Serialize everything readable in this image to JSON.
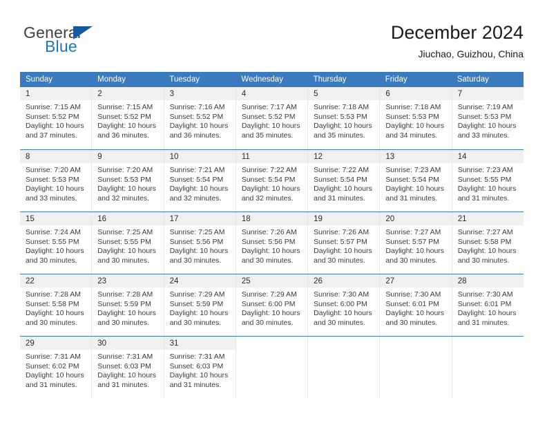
{
  "brand": {
    "name_part1": "General",
    "name_part2": "Blue",
    "accent_color": "#1b76c4",
    "triangle_color": "#17599c"
  },
  "header": {
    "title": "December 2024",
    "subtitle": "Jiuchao, Guizhou, China"
  },
  "theme": {
    "header_blue": "#3a7bbf",
    "daynum_band": "#f0f0f0",
    "cell_separator": "#e6e6e6"
  },
  "weekdays": [
    "Sunday",
    "Monday",
    "Tuesday",
    "Wednesday",
    "Thursday",
    "Friday",
    "Saturday"
  ],
  "weeks": [
    [
      {
        "day": "1",
        "sunrise": "Sunrise: 7:15 AM",
        "sunset": "Sunset: 5:52 PM",
        "daylight1": "Daylight: 10 hours",
        "daylight2": "and 37 minutes."
      },
      {
        "day": "2",
        "sunrise": "Sunrise: 7:15 AM",
        "sunset": "Sunset: 5:52 PM",
        "daylight1": "Daylight: 10 hours",
        "daylight2": "and 36 minutes."
      },
      {
        "day": "3",
        "sunrise": "Sunrise: 7:16 AM",
        "sunset": "Sunset: 5:52 PM",
        "daylight1": "Daylight: 10 hours",
        "daylight2": "and 36 minutes."
      },
      {
        "day": "4",
        "sunrise": "Sunrise: 7:17 AM",
        "sunset": "Sunset: 5:52 PM",
        "daylight1": "Daylight: 10 hours",
        "daylight2": "and 35 minutes."
      },
      {
        "day": "5",
        "sunrise": "Sunrise: 7:18 AM",
        "sunset": "Sunset: 5:53 PM",
        "daylight1": "Daylight: 10 hours",
        "daylight2": "and 35 minutes."
      },
      {
        "day": "6",
        "sunrise": "Sunrise: 7:18 AM",
        "sunset": "Sunset: 5:53 PM",
        "daylight1": "Daylight: 10 hours",
        "daylight2": "and 34 minutes."
      },
      {
        "day": "7",
        "sunrise": "Sunrise: 7:19 AM",
        "sunset": "Sunset: 5:53 PM",
        "daylight1": "Daylight: 10 hours",
        "daylight2": "and 33 minutes."
      }
    ],
    [
      {
        "day": "8",
        "sunrise": "Sunrise: 7:20 AM",
        "sunset": "Sunset: 5:53 PM",
        "daylight1": "Daylight: 10 hours",
        "daylight2": "and 33 minutes."
      },
      {
        "day": "9",
        "sunrise": "Sunrise: 7:20 AM",
        "sunset": "Sunset: 5:53 PM",
        "daylight1": "Daylight: 10 hours",
        "daylight2": "and 32 minutes."
      },
      {
        "day": "10",
        "sunrise": "Sunrise: 7:21 AM",
        "sunset": "Sunset: 5:54 PM",
        "daylight1": "Daylight: 10 hours",
        "daylight2": "and 32 minutes."
      },
      {
        "day": "11",
        "sunrise": "Sunrise: 7:22 AM",
        "sunset": "Sunset: 5:54 PM",
        "daylight1": "Daylight: 10 hours",
        "daylight2": "and 32 minutes."
      },
      {
        "day": "12",
        "sunrise": "Sunrise: 7:22 AM",
        "sunset": "Sunset: 5:54 PM",
        "daylight1": "Daylight: 10 hours",
        "daylight2": "and 31 minutes."
      },
      {
        "day": "13",
        "sunrise": "Sunrise: 7:23 AM",
        "sunset": "Sunset: 5:54 PM",
        "daylight1": "Daylight: 10 hours",
        "daylight2": "and 31 minutes."
      },
      {
        "day": "14",
        "sunrise": "Sunrise: 7:23 AM",
        "sunset": "Sunset: 5:55 PM",
        "daylight1": "Daylight: 10 hours",
        "daylight2": "and 31 minutes."
      }
    ],
    [
      {
        "day": "15",
        "sunrise": "Sunrise: 7:24 AM",
        "sunset": "Sunset: 5:55 PM",
        "daylight1": "Daylight: 10 hours",
        "daylight2": "and 30 minutes."
      },
      {
        "day": "16",
        "sunrise": "Sunrise: 7:25 AM",
        "sunset": "Sunset: 5:55 PM",
        "daylight1": "Daylight: 10 hours",
        "daylight2": "and 30 minutes."
      },
      {
        "day": "17",
        "sunrise": "Sunrise: 7:25 AM",
        "sunset": "Sunset: 5:56 PM",
        "daylight1": "Daylight: 10 hours",
        "daylight2": "and 30 minutes."
      },
      {
        "day": "18",
        "sunrise": "Sunrise: 7:26 AM",
        "sunset": "Sunset: 5:56 PM",
        "daylight1": "Daylight: 10 hours",
        "daylight2": "and 30 minutes."
      },
      {
        "day": "19",
        "sunrise": "Sunrise: 7:26 AM",
        "sunset": "Sunset: 5:57 PM",
        "daylight1": "Daylight: 10 hours",
        "daylight2": "and 30 minutes."
      },
      {
        "day": "20",
        "sunrise": "Sunrise: 7:27 AM",
        "sunset": "Sunset: 5:57 PM",
        "daylight1": "Daylight: 10 hours",
        "daylight2": "and 30 minutes."
      },
      {
        "day": "21",
        "sunrise": "Sunrise: 7:27 AM",
        "sunset": "Sunset: 5:58 PM",
        "daylight1": "Daylight: 10 hours",
        "daylight2": "and 30 minutes."
      }
    ],
    [
      {
        "day": "22",
        "sunrise": "Sunrise: 7:28 AM",
        "sunset": "Sunset: 5:58 PM",
        "daylight1": "Daylight: 10 hours",
        "daylight2": "and 30 minutes."
      },
      {
        "day": "23",
        "sunrise": "Sunrise: 7:28 AM",
        "sunset": "Sunset: 5:59 PM",
        "daylight1": "Daylight: 10 hours",
        "daylight2": "and 30 minutes."
      },
      {
        "day": "24",
        "sunrise": "Sunrise: 7:29 AM",
        "sunset": "Sunset: 5:59 PM",
        "daylight1": "Daylight: 10 hours",
        "daylight2": "and 30 minutes."
      },
      {
        "day": "25",
        "sunrise": "Sunrise: 7:29 AM",
        "sunset": "Sunset: 6:00 PM",
        "daylight1": "Daylight: 10 hours",
        "daylight2": "and 30 minutes."
      },
      {
        "day": "26",
        "sunrise": "Sunrise: 7:30 AM",
        "sunset": "Sunset: 6:00 PM",
        "daylight1": "Daylight: 10 hours",
        "daylight2": "and 30 minutes."
      },
      {
        "day": "27",
        "sunrise": "Sunrise: 7:30 AM",
        "sunset": "Sunset: 6:01 PM",
        "daylight1": "Daylight: 10 hours",
        "daylight2": "and 30 minutes."
      },
      {
        "day": "28",
        "sunrise": "Sunrise: 7:30 AM",
        "sunset": "Sunset: 6:01 PM",
        "daylight1": "Daylight: 10 hours",
        "daylight2": "and 31 minutes."
      }
    ],
    [
      {
        "day": "29",
        "sunrise": "Sunrise: 7:31 AM",
        "sunset": "Sunset: 6:02 PM",
        "daylight1": "Daylight: 10 hours",
        "daylight2": "and 31 minutes."
      },
      {
        "day": "30",
        "sunrise": "Sunrise: 7:31 AM",
        "sunset": "Sunset: 6:03 PM",
        "daylight1": "Daylight: 10 hours",
        "daylight2": "and 31 minutes."
      },
      {
        "day": "31",
        "sunrise": "Sunrise: 7:31 AM",
        "sunset": "Sunset: 6:03 PM",
        "daylight1": "Daylight: 10 hours",
        "daylight2": "and 31 minutes."
      },
      {
        "day": "",
        "sunrise": "",
        "sunset": "",
        "daylight1": "",
        "daylight2": ""
      },
      {
        "day": "",
        "sunrise": "",
        "sunset": "",
        "daylight1": "",
        "daylight2": ""
      },
      {
        "day": "",
        "sunrise": "",
        "sunset": "",
        "daylight1": "",
        "daylight2": ""
      },
      {
        "day": "",
        "sunrise": "",
        "sunset": "",
        "daylight1": "",
        "daylight2": ""
      }
    ]
  ]
}
